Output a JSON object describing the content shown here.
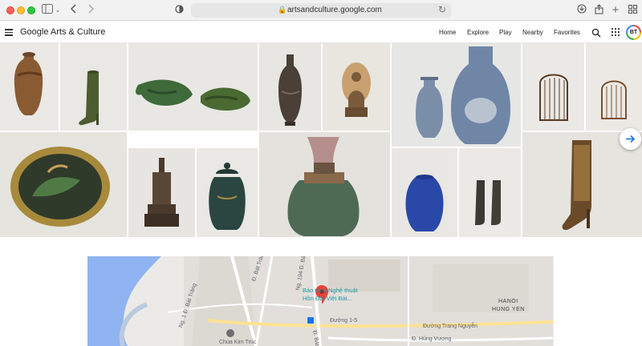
{
  "browser": {
    "url": "artsandculture.google.com"
  },
  "header": {
    "logo": "Google Arts & Culture",
    "nav": [
      "Home",
      "Explore",
      "Play",
      "Nearby",
      "Favorites"
    ],
    "avatar_initials": "BT"
  },
  "gallery": {
    "tiles": [
      {
        "name": "tile-amphora-vase"
      },
      {
        "name": "tile-green-boot"
      },
      {
        "name": "tile-fish-sculptures"
      },
      {
        "name": "tile-tall-vase"
      },
      {
        "name": "tile-buddha-statue"
      },
      {
        "name": "tile-blue-white-vases"
      },
      {
        "name": "tile-birdcage-dark"
      },
      {
        "name": "tile-birdcage-light"
      },
      {
        "name": "tile-painted-plate"
      },
      {
        "name": "tile-stupa-figure"
      },
      {
        "name": "tile-lidded-jar"
      },
      {
        "name": "tile-drip-glaze-vase"
      },
      {
        "name": "tile-blue-jar"
      },
      {
        "name": "tile-pair-of-boots"
      },
      {
        "name": "tile-decorated-boot"
      }
    ]
  },
  "map": {
    "poi_lines": [
      "Bảo tàng Nghệ thuật",
      "Hồn Đất Việt Bát..."
    ],
    "roads": [
      "Đ. Bát Tràng",
      "Ng. 194 Đ. Bát",
      "Đ. Bát Tràng",
      "Ng. 1 Đ. Bát Tràng",
      "Đường 1-5",
      "Đường Trang Nguyễn",
      "Đ. Hùng Vương",
      "Đ. Bát Tr"
    ],
    "city_lines": [
      "HANOI",
      "HUNG YEN"
    ],
    "bottom_label": "Chùa Kim Trúc"
  }
}
